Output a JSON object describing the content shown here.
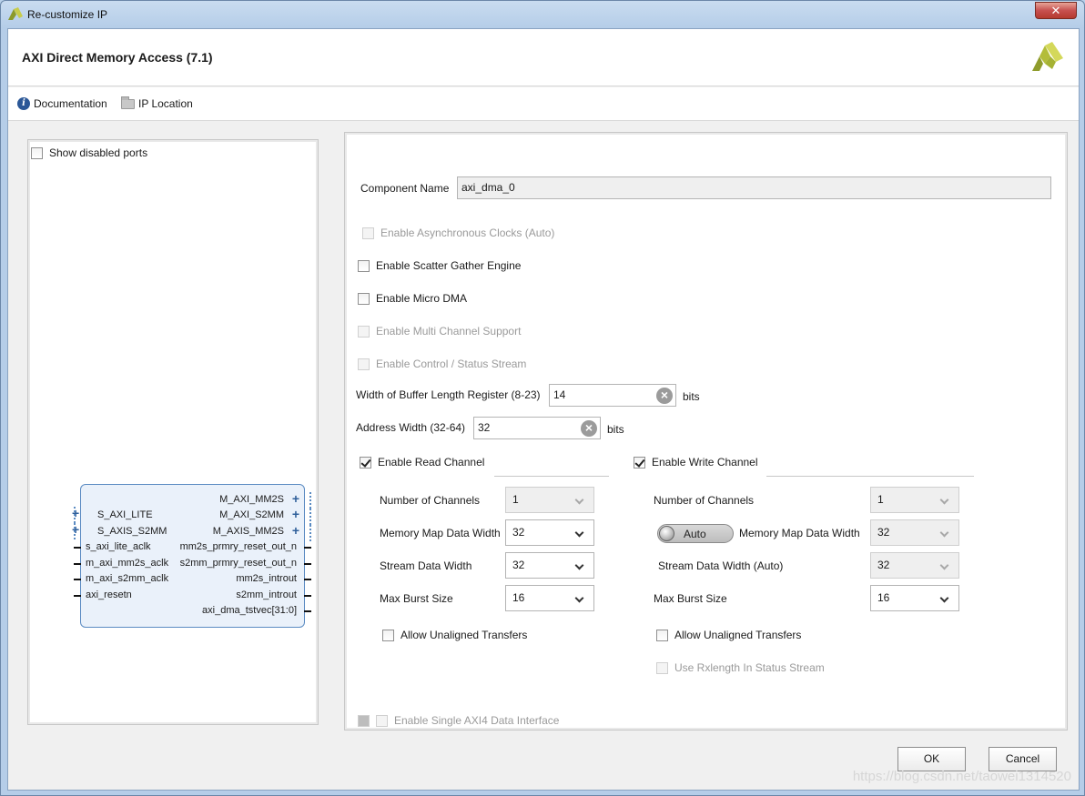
{
  "window": {
    "title": "Re-customize IP",
    "close": "✕"
  },
  "header": {
    "ip_title": "AXI Direct Memory Access (7.1)"
  },
  "links": {
    "documentation": "Documentation",
    "ip_location": "IP Location"
  },
  "left": {
    "show_disabled_ports": "Show disabled ports",
    "ports_left": [
      "S_AXI_LITE",
      "S_AXIS_S2MM",
      "s_axi_lite_aclk",
      "m_axi_mm2s_aclk",
      "m_axi_s2mm_aclk",
      "axi_resetn"
    ],
    "ports_right": [
      "M_AXI_MM2S",
      "M_AXI_S2MM",
      "M_AXIS_MM2S",
      "mm2s_prmry_reset_out_n",
      "s2mm_prmry_reset_out_n",
      "mm2s_introut",
      "s2mm_introut",
      "axi_dma_tstvec[31:0]"
    ]
  },
  "config": {
    "component_name_label": "Component Name",
    "component_name_value": "axi_dma_0",
    "async_clocks": "Enable Asynchronous Clocks (Auto)",
    "scatter_gather": "Enable Scatter Gather Engine",
    "micro_dma": "Enable Micro DMA",
    "multi_channel": "Enable Multi Channel Support",
    "control_status": "Enable Control / Status Stream",
    "buffer_len_label": "Width of Buffer Length Register (8-23)",
    "buffer_len_value": "14",
    "bits1": "bits",
    "addr_width_label": "Address Width (32-64)",
    "addr_width_value": "32",
    "bits2": "bits",
    "single_axi4": "Enable Single AXI4 Data Interface"
  },
  "read": {
    "enable": "Enable Read Channel",
    "num_channels_label": "Number of Channels",
    "num_channels_value": "1",
    "mm_width_label": "Memory Map Data Width",
    "mm_width_value": "32",
    "stream_width_label": "Stream Data Width",
    "stream_width_value": "32",
    "burst_label": "Max Burst Size",
    "burst_value": "16",
    "unaligned": "Allow Unaligned Transfers"
  },
  "write": {
    "enable": "Enable Write Channel",
    "num_channels_label": "Number of Channels",
    "num_channels_value": "1",
    "auto_toggle": "Auto",
    "mm_width_label": "Memory Map Data Width",
    "mm_width_value": "32",
    "stream_width_label": "Stream Data Width (Auto)",
    "stream_width_value": "32",
    "burst_label": "Max Burst Size",
    "burst_value": "16",
    "unaligned": "Allow Unaligned Transfers",
    "rxlength": "Use Rxlength In Status Stream"
  },
  "buttons": {
    "ok": "OK",
    "cancel": "Cancel"
  },
  "watermark": "https://blog.csdn.net/taowei1314520"
}
